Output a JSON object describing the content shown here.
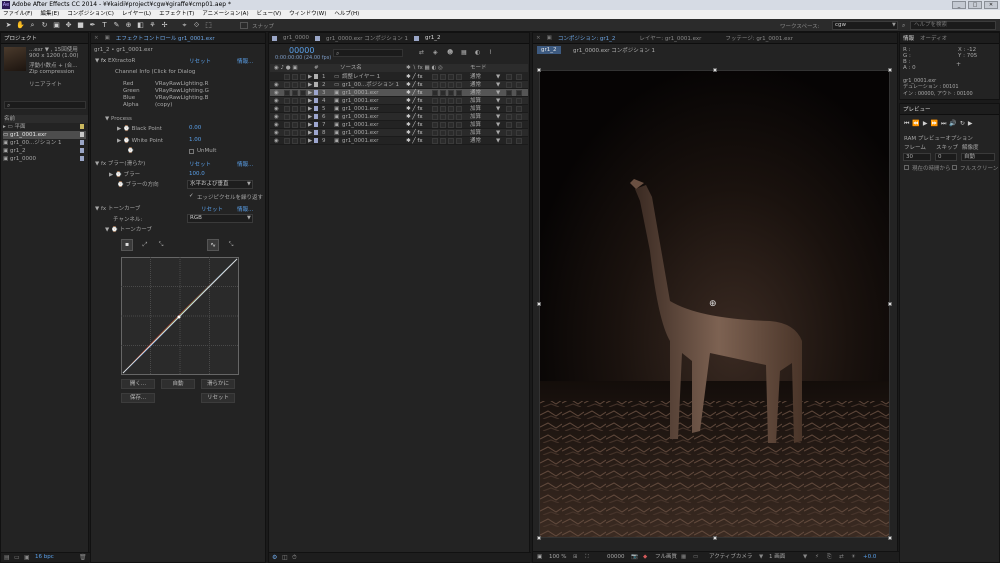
{
  "window": {
    "title": "Adobe After Effects CC 2014 - ¥¥kaidi¥project¥cgw¥giraffe¥cmp01.aep *",
    "controls": [
      "_",
      "□",
      "✕"
    ]
  },
  "menu": [
    "ファイル(F)",
    "編集(E)",
    "コンポジション(C)",
    "レイヤー(L)",
    "エフェクト(T)",
    "アニメーション(A)",
    "ビュー(V)",
    "ウィンドウ(W)",
    "ヘルプ(H)"
  ],
  "toolbar": {
    "snap_label": "スナップ",
    "workspace_label": "ワークスペース:",
    "workspace_value": "cgw",
    "help_placeholder": "ヘルプを検索"
  },
  "project": {
    "tab": "プロジェクト",
    "info_name": "...exr ▼ , 15回使用",
    "info_dims": "900 x 1200 (1.00)",
    "info_depth": "浮動小数点 + (合...",
    "info_comp": "Zip compression",
    "info_color": "リニアライト",
    "col_name": "名前",
    "items": [
      {
        "name": "平面",
        "color": "#c9b75e",
        "kind": "folder"
      },
      {
        "name": "gr1_0001.exr",
        "color": "#c8c8c8",
        "kind": "footage",
        "selected": true
      },
      {
        "name": "gr1_00...ジション 1",
        "color": "#9aa6c7",
        "kind": "comp"
      },
      {
        "name": "gr1_2",
        "color": "#9aa6c7",
        "kind": "comp"
      },
      {
        "name": "gr1_0000",
        "color": "#9aa6c7",
        "kind": "comp"
      }
    ],
    "bpc": "16 bpc"
  },
  "effects": {
    "tab": "エフェクトコントロール gr1_0001.exr",
    "breadcrumb": "gr1_2 • gr1_0001.exr",
    "reset": "リセット",
    "about": "情報...",
    "extractor": {
      "name": "EXtractoR",
      "channel_info": "Channel Info (Click for Dialog",
      "channels": [
        {
          "k": "Red",
          "v": "VRayRawLighting.R"
        },
        {
          "k": "Green",
          "v": "VRayRawLighting.G"
        },
        {
          "k": "Blue",
          "v": "VRayRawLighting.B"
        },
        {
          "k": "Alpha",
          "v": "(copy)"
        }
      ],
      "process": "Process",
      "black_point": "Black Point",
      "black_value": "0.00",
      "white_point": "White Point",
      "white_value": "1.00",
      "unmult": "UnMult"
    },
    "blur": {
      "name": "ブラー(滑らか)",
      "amount_label": "ブラー",
      "amount_value": "100.0",
      "dir_label": "ブラーの方向",
      "dir_value": "水平および垂直",
      "repeat_label": "エッジピクセルを繰り返す"
    },
    "curves": {
      "name": "トーンカーブ",
      "channel_label": "チャンネル:",
      "channel_value": "RGB",
      "curve_label": "トーンカーブ",
      "buttons": {
        "open": "開く...",
        "auto": "自動",
        "smooth": "滑らかに",
        "save": "保存...",
        "reset": "リセット"
      }
    }
  },
  "timeline": {
    "tabs": [
      "gr1_0000",
      "gr1_0000.exr コンポジション 1",
      "gr1_2"
    ],
    "timecode": "00000",
    "fps": "0:00:00:00 (24.00 fps)",
    "col_source": "ソース名",
    "col_mode": "モード",
    "layers": [
      {
        "num": "1",
        "name": "調整レイヤー 1",
        "mode": "通常",
        "color": "#b0b0b0"
      },
      {
        "num": "2",
        "name": "gr1_00...ポジション 1",
        "mode": "通常",
        "color": "#b0b0b0"
      },
      {
        "num": "3",
        "name": "gr1_0001.exr",
        "mode": "通常",
        "color": "#9da6cf"
      },
      {
        "num": "4",
        "name": "gr1_0001.exr",
        "mode": "加算",
        "color": "#9da6cf"
      },
      {
        "num": "5",
        "name": "gr1_0001.exr",
        "mode": "加算",
        "color": "#9da6cf"
      },
      {
        "num": "6",
        "name": "gr1_0001.exr",
        "mode": "加算",
        "color": "#9da6cf"
      },
      {
        "num": "7",
        "name": "gr1_0001.exr",
        "mode": "加算",
        "color": "#9da6cf"
      },
      {
        "num": "8",
        "name": "gr1_0001.exr",
        "mode": "加算",
        "color": "#9da6cf"
      },
      {
        "num": "9",
        "name": "gr1_0001.exr",
        "mode": "通常",
        "color": "#9da6cf"
      }
    ]
  },
  "viewer": {
    "tabs": [
      "コンポジション: gr1_2",
      "レイヤー: gr1_0001.exr",
      "フッテージ: gr1_0001.exr"
    ],
    "subtabs": [
      "gr1_2",
      "gr1_0000.exr コンポジション 1"
    ],
    "zoom": "100 %",
    "time": "00000",
    "quality": "フル画質",
    "camera": "アクティブカメラ",
    "views": "1 画面",
    "plus": "+0.0"
  },
  "info": {
    "tabs": [
      "情報",
      "オーディオ"
    ],
    "r": "R :",
    "g": "G :",
    "b": "B :",
    "a": "A : 0",
    "x": "X : -12",
    "y": "Y : 705",
    "file": "gr1_0001.exr",
    "duration": "デュレーション : 00101",
    "inout": "イン : 00000, アウト : 00100"
  },
  "preview": {
    "tab": "プレビュー",
    "ram": "RAM プレビューオプション",
    "frame_label": "フレーム",
    "skip_label": "スキップ",
    "res_label": "解像度",
    "frame_value": "30",
    "skip_value": "0",
    "res_value": "自動",
    "from_current": "現在の時間から",
    "fullscreen": "フルスクリーン"
  },
  "colors": {
    "accent": "#5aa0ea",
    "panel": "#232323",
    "selection": "#4d4d4d"
  }
}
